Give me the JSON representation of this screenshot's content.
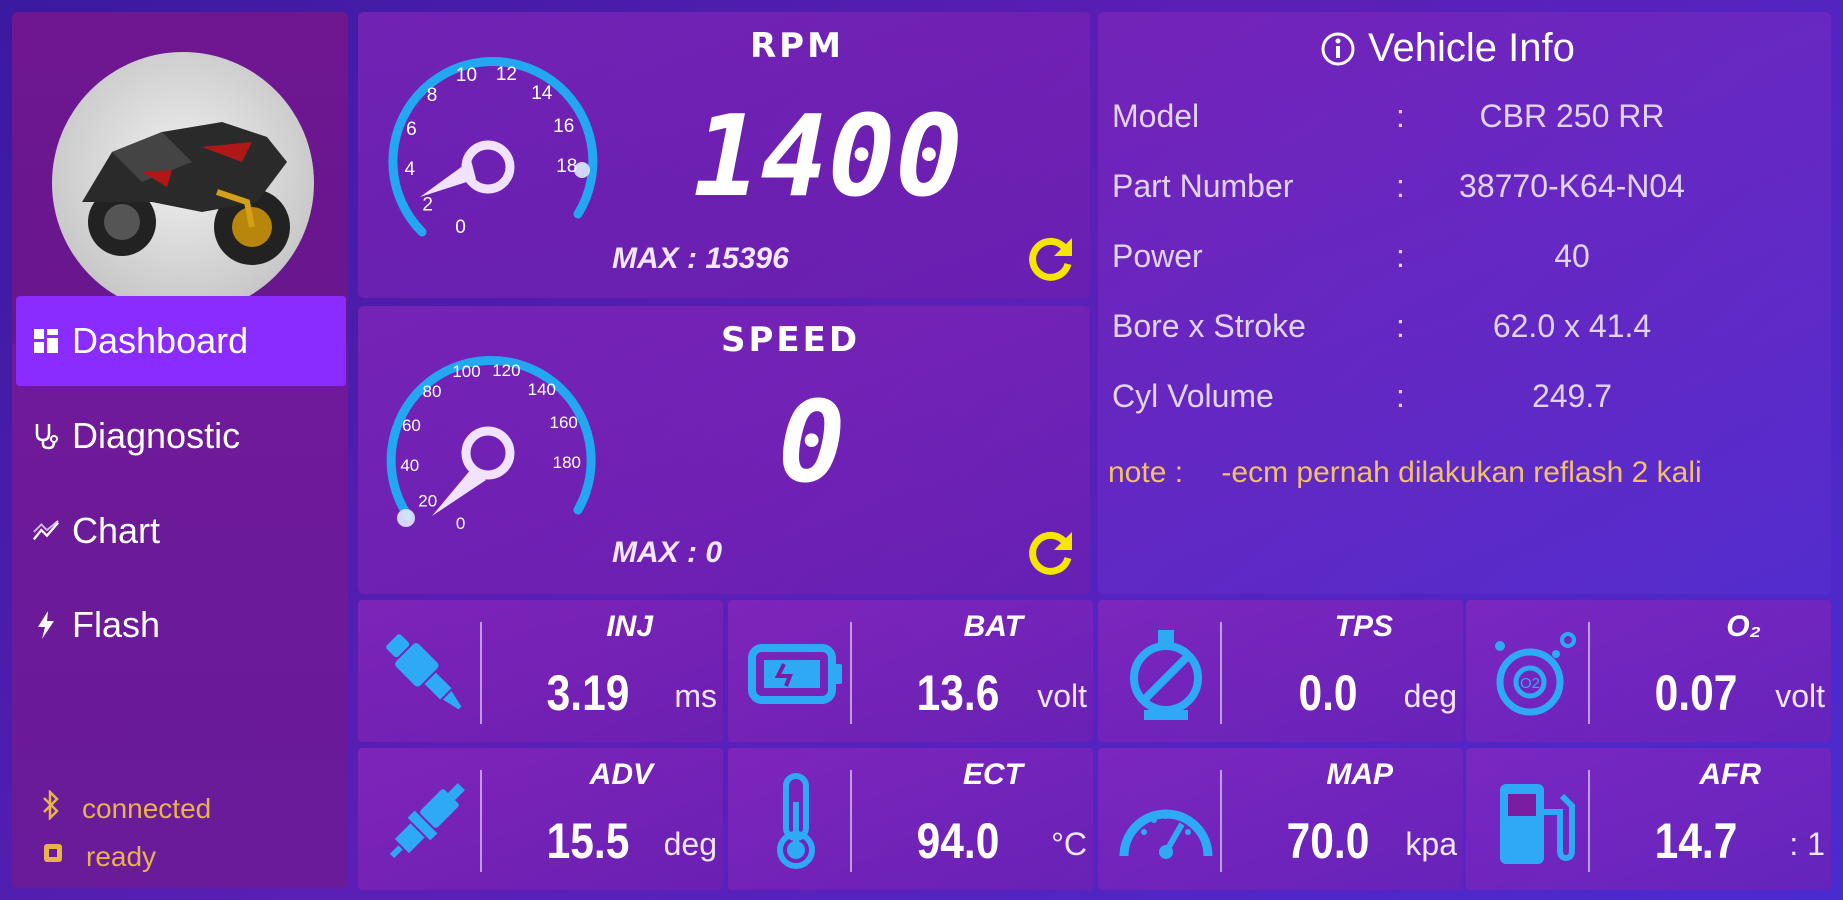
{
  "sidebar": {
    "nav": [
      {
        "label": "Dashboard",
        "icon": "dashboard-icon",
        "active": true
      },
      {
        "label": "Diagnostic",
        "icon": "stethoscope-icon",
        "active": false
      },
      {
        "label": "Chart",
        "icon": "chart-icon",
        "active": false
      },
      {
        "label": "Flash",
        "icon": "flash-icon",
        "active": false
      }
    ],
    "status": [
      {
        "label": "connected",
        "icon": "bluetooth-icon"
      },
      {
        "label": "ready",
        "icon": "ecu-icon"
      }
    ]
  },
  "rpm": {
    "title": "RPM",
    "value": "1400",
    "max_label": "MAX :",
    "max_value": "15396",
    "ticks": [
      "0",
      "2",
      "4",
      "6",
      "8",
      "10",
      "12",
      "14",
      "16",
      "18"
    ]
  },
  "speed": {
    "title": "SPEED",
    "value": "0",
    "max_label": "MAX :",
    "max_value": "0",
    "ticks": [
      "0",
      "20",
      "40",
      "60",
      "80",
      "100",
      "120",
      "140",
      "160",
      "180"
    ]
  },
  "vehicle_info": {
    "title": "Vehicle Info",
    "rows": [
      {
        "key": "Model",
        "sep": ":",
        "value": "CBR 250 RR"
      },
      {
        "key": "Part Number",
        "sep": ":",
        "value": "38770-K64-N04"
      },
      {
        "key": "Power",
        "sep": ":",
        "value": "40"
      },
      {
        "key": "Bore x Stroke",
        "sep": ":",
        "value": "62.0 x 41.4"
      },
      {
        "key": "Cyl Volume",
        "sep": ":",
        "value": "249.7"
      }
    ],
    "note_label": "note :",
    "note_text": "-ecm pernah dilakukan reflash 2 kali"
  },
  "sensors": [
    {
      "label": "INJ",
      "value": "3.19",
      "unit": "ms",
      "icon": "injector-icon"
    },
    {
      "label": "BAT",
      "value": "13.6",
      "unit": "volt",
      "icon": "battery-icon"
    },
    {
      "label": "TPS",
      "value": "0.0",
      "unit": "deg",
      "icon": "throttle-icon"
    },
    {
      "label": "O₂",
      "value": "0.07",
      "unit": "volt",
      "icon": "oxygen-sensor-icon"
    },
    {
      "label": "ADV",
      "value": "15.5",
      "unit": "deg",
      "icon": "spark-plug-icon"
    },
    {
      "label": "ECT",
      "value": "94.0",
      "unit": "°C",
      "icon": "thermometer-icon"
    },
    {
      "label": "MAP",
      "value": "70.0",
      "unit": "kpa",
      "icon": "pressure-gauge-icon"
    },
    {
      "label": "AFR",
      "value": "14.7",
      "unit": ": 1",
      "icon": "fuel-pump-icon"
    }
  ],
  "colors": {
    "accent": "#8a2bff",
    "gauge_arc": "#22a7f0",
    "icon_blue": "#2eaaf5",
    "reset_yellow": "#f4e600",
    "status_amber": "#e7b34a",
    "note_amber": "#f0c16a"
  }
}
